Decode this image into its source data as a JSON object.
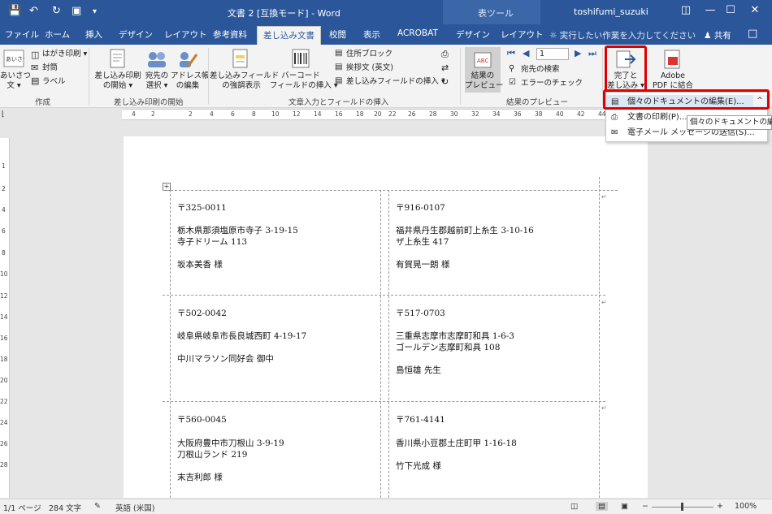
{
  "titlebar": {
    "doc_title": "文書 2 [互換モード]  -  Word",
    "tool_label": "表ツール",
    "user": "toshifumi_suzuki",
    "save_icon": "save-icon",
    "undo_icon": "undo-icon",
    "redo_icon": "redo-icon",
    "print_preview_icon": "print-preview-icon"
  },
  "tabs": [
    "ファイル",
    "ホーム",
    "挿入",
    "デザイン",
    "レイアウト",
    "参考資料",
    "差し込み文書",
    "校閲",
    "表示",
    "ACROBAT",
    "デザイン",
    "レイアウト"
  ],
  "tellme": "実行したい作業を入力してください",
  "share": "共有",
  "ribbon": {
    "create": {
      "label": "作成",
      "aisatsu": "あいさつ",
      "bun": "文 ▾",
      "hagaki": "はがき印刷 ▾",
      "futo": "封筒",
      "label_btn": "ラベル",
      "sample_icon": "あいさつ"
    },
    "start": {
      "label": "差し込み印刷の開始",
      "start_btn_1": "差し込み印刷",
      "start_btn_2": "の開始 ▾",
      "select_1": "宛先の",
      "select_2": "選択 ▾",
      "edit_1": "アドレス帳",
      "edit_2": "の編集"
    },
    "write": {
      "label": "文章入力とフィールドの挿入",
      "highlight_1": "差し込みフィールド",
      "highlight_2": "の強調表示",
      "barcode_1": "バーコード",
      "barcode_2": "フィールドの挿入 ▾",
      "address_block": "住所ブロック",
      "greeting": "挨拶文 (英文)",
      "insert_field": "差し込みフィールドの挿入 ▾"
    },
    "preview": {
      "label": "結果のプレビュー",
      "preview_1": "結果の",
      "preview_2": "プレビュー",
      "record_value": "1",
      "find": "宛先の検索",
      "check": "エラーのチェック"
    },
    "finish": {
      "finish_1": "完了と",
      "finish_2": "差し込み ▾",
      "adobe_1": "Adobe",
      "adobe_2": "PDF に結合"
    }
  },
  "ruler": [
    "4",
    "2",
    "2",
    "4",
    "6",
    "8",
    "10",
    "12",
    "14",
    "16",
    "18",
    "20",
    "22",
    "26",
    "28",
    "30",
    "32",
    "34",
    "36",
    "38",
    "40",
    "42",
    "44"
  ],
  "vruler": [
    "1",
    "2",
    "4",
    "6",
    "8",
    "10",
    "12",
    "14",
    "16",
    "18",
    "20",
    "22",
    "24",
    "26",
    "28"
  ],
  "dropdown": {
    "edit_docs": "個々のドキュメントの編集(E)...",
    "print_docs": "文書の印刷(P)...",
    "email": "電子メール メッセージの送信(S)...",
    "tooltip": "個々のドキュメントの編集",
    "collapse": "^"
  },
  "labels": [
    {
      "zip": "〒325-0011",
      "addr1": "栃木県那須塩原市寺子 3-19-15",
      "addr2": "寺子ドリーム 113",
      "name": "坂本美香  様"
    },
    {
      "zip": "〒916-0107",
      "addr1": "福井県丹生郡越前町上糸生 3-10-16",
      "addr2": "ザ上糸生 417",
      "name": "有賀晃一朗  様"
    },
    {
      "zip": "〒502-0042",
      "addr1": "岐阜県岐阜市長良城西町 4-19-17",
      "addr2": "",
      "name": "中川マラソン同好会  御中"
    },
    {
      "zip": "〒517-0703",
      "addr1": "三重県志摩市志摩町和具 1-6-3",
      "addr2": "ゴールデン志摩町和具 108",
      "name": "島恒雄  先生"
    },
    {
      "zip": "〒560-0045",
      "addr1": "大阪府豊中市刀根山 3-9-19",
      "addr2": "刀根山ランド 219",
      "name": "末吉利郎  様"
    },
    {
      "zip": "〒761-4141",
      "addr1": "香川県小豆郡土庄町甲 1-16-18",
      "addr2": "",
      "name": "竹下光成  様"
    }
  ],
  "status": {
    "page": "1/1 ページ",
    "words": "284 文字",
    "lang": "英語 (米国)",
    "zoom": "100%"
  },
  "colors": {
    "accent": "#2b579a",
    "highlight": "#e00000"
  }
}
